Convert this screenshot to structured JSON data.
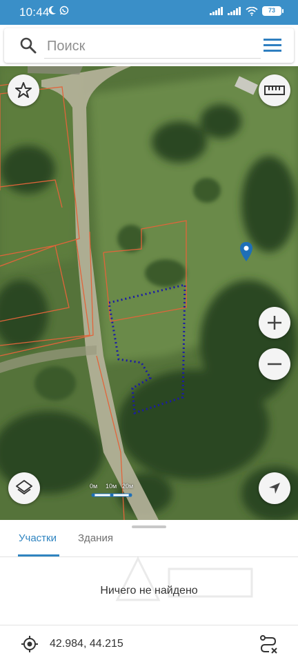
{
  "status_bar": {
    "time": "10:44",
    "battery": "73",
    "icons": [
      "moon-icon",
      "whatsapp-icon",
      "signal-icon",
      "signal-icon",
      "wifi-icon",
      "battery-icon"
    ]
  },
  "search": {
    "placeholder": "Поиск",
    "value": ""
  },
  "map": {
    "scale_labels": [
      "0м",
      "10м",
      "20м"
    ],
    "controls": [
      "favorites-star-icon",
      "ruler-icon",
      "zoom-in-icon",
      "zoom-out-icon",
      "layers-icon",
      "navigation-arrow-icon"
    ],
    "marker_color": "#1e6fb8",
    "plot_border_color": "#e2643a",
    "selection_color": "#1a1aa8"
  },
  "panel": {
    "tabs": [
      {
        "label": "Участки",
        "active": true
      },
      {
        "label": "Здания",
        "active": false
      }
    ],
    "empty_message": "Ничего не найдено"
  },
  "footer": {
    "coordinates": "42.984, 44.215"
  },
  "colors": {
    "accent": "#2f84c0",
    "status_bar": "#3a8fc8"
  }
}
